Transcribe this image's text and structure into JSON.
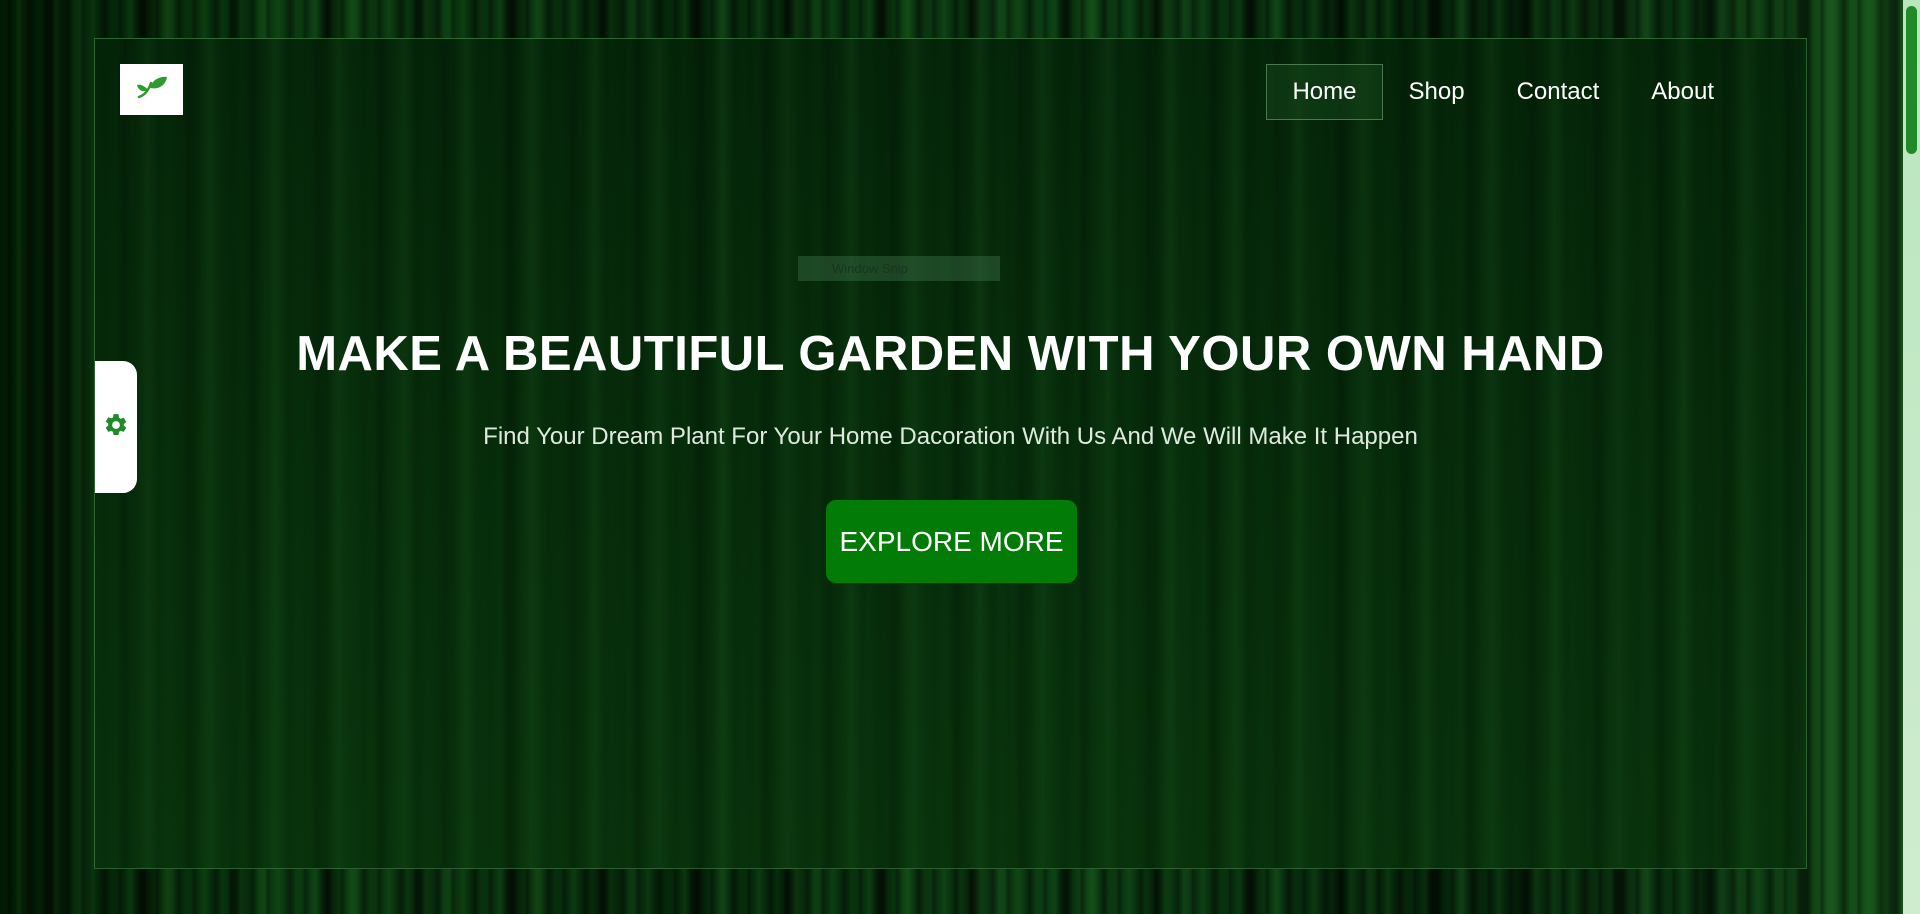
{
  "header": {
    "logo_icon": "leaf-icon",
    "nav": [
      {
        "label": "Home",
        "active": true
      },
      {
        "label": "Shop",
        "active": false
      },
      {
        "label": "Contact",
        "active": false
      },
      {
        "label": "About",
        "active": false
      }
    ]
  },
  "overlay": {
    "snip_label": "Window Snip"
  },
  "hero": {
    "title": "MAKE A BEAUTIFUL GARDEN WITH YOUR OWN HAND",
    "subtitle": "Find Your Dream Plant For Your Home Dacoration With Us And We Will Make It Happen",
    "cta_label": "EXPLORE MORE"
  },
  "settings": {
    "icon": "gear-icon"
  },
  "colors": {
    "accent": "#027c07",
    "leaf": "#2e9b2e",
    "text": "#ffffff"
  }
}
